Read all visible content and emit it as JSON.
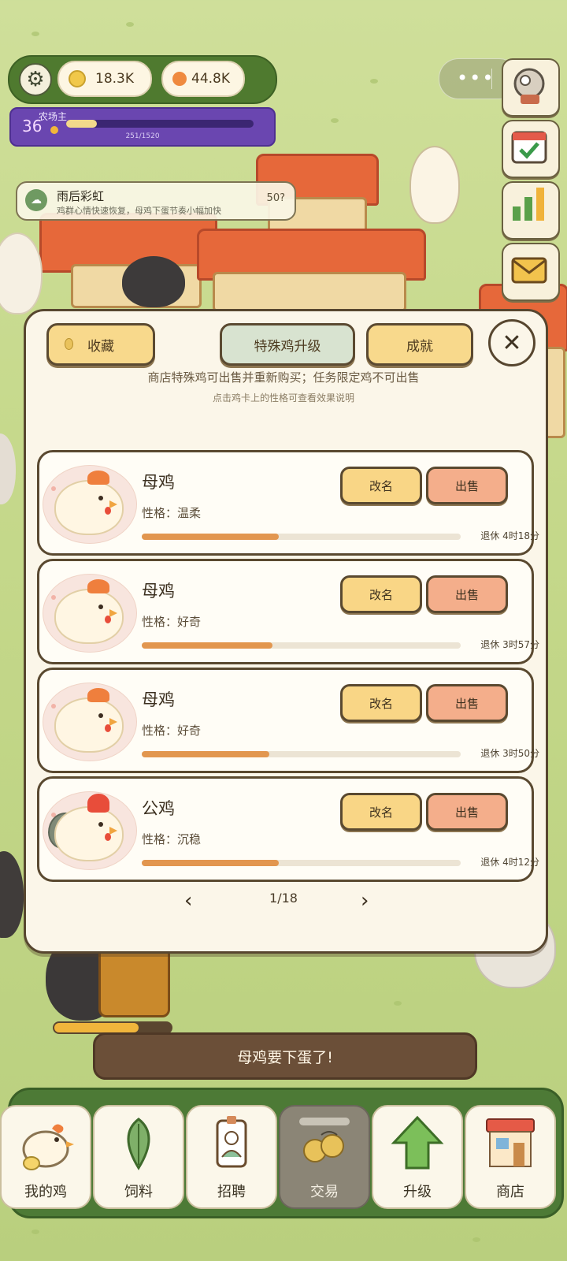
{
  "hud": {
    "coins": "18.3K",
    "gems": "44.8K",
    "level": "36",
    "level_title": "农场主",
    "xp_text": "251/1520",
    "xp_progress": 0.165,
    "rank_label": "榜"
  },
  "weather": {
    "title": "雨后彩虹",
    "description": "鸡群心情快速恢复，母鸡下蛋节奏小幅加快",
    "timer": "50?"
  },
  "dialog": {
    "tabs": {
      "collection": "收藏",
      "special_upgrade": "特殊鸡升级",
      "achievements": "成就"
    },
    "notice_line1": "商店特殊鸡可出售并重新购买；任务限定鸡不可出售",
    "notice_line2": "点击鸡卡上的性格可查看效果说明",
    "rename_label": "改名",
    "sell_label": "出售",
    "chickens": [
      {
        "name": "母鸡",
        "trait": "性格：温柔",
        "retire": "退休 4时18分",
        "progress": 0.43
      },
      {
        "name": "母鸡",
        "trait": "性格：好奇",
        "retire": "退休 3时57分",
        "progress": 0.41
      },
      {
        "name": "母鸡",
        "trait": "性格：好奇",
        "retire": "退休 3时50分",
        "progress": 0.4
      },
      {
        "name": "公鸡",
        "trait": "性格：沉稳",
        "retire": "退休 4时12分",
        "progress": 0.43
      }
    ],
    "pager": {
      "prev": "‹",
      "next": "›",
      "text": "1/18"
    }
  },
  "toast": "母鸡要下蛋了!",
  "lay_progress": 0.72,
  "nav": [
    {
      "label": "我的鸡",
      "icon": "chicken-icon"
    },
    {
      "label": "饲料",
      "icon": "leaf-icon"
    },
    {
      "label": "招聘",
      "icon": "badge-icon"
    },
    {
      "label": "交易",
      "icon": "trade-icon"
    },
    {
      "label": "升级",
      "icon": "up-arrow-icon"
    },
    {
      "label": "商店",
      "icon": "shop-icon"
    }
  ],
  "colors": {
    "accent_yellow": "#f9d686",
    "accent_salmon": "#f4ae8b",
    "progress_orange": "#e2964f",
    "nav_green": "#4d7a36",
    "level_purple": "#6a46b0"
  }
}
